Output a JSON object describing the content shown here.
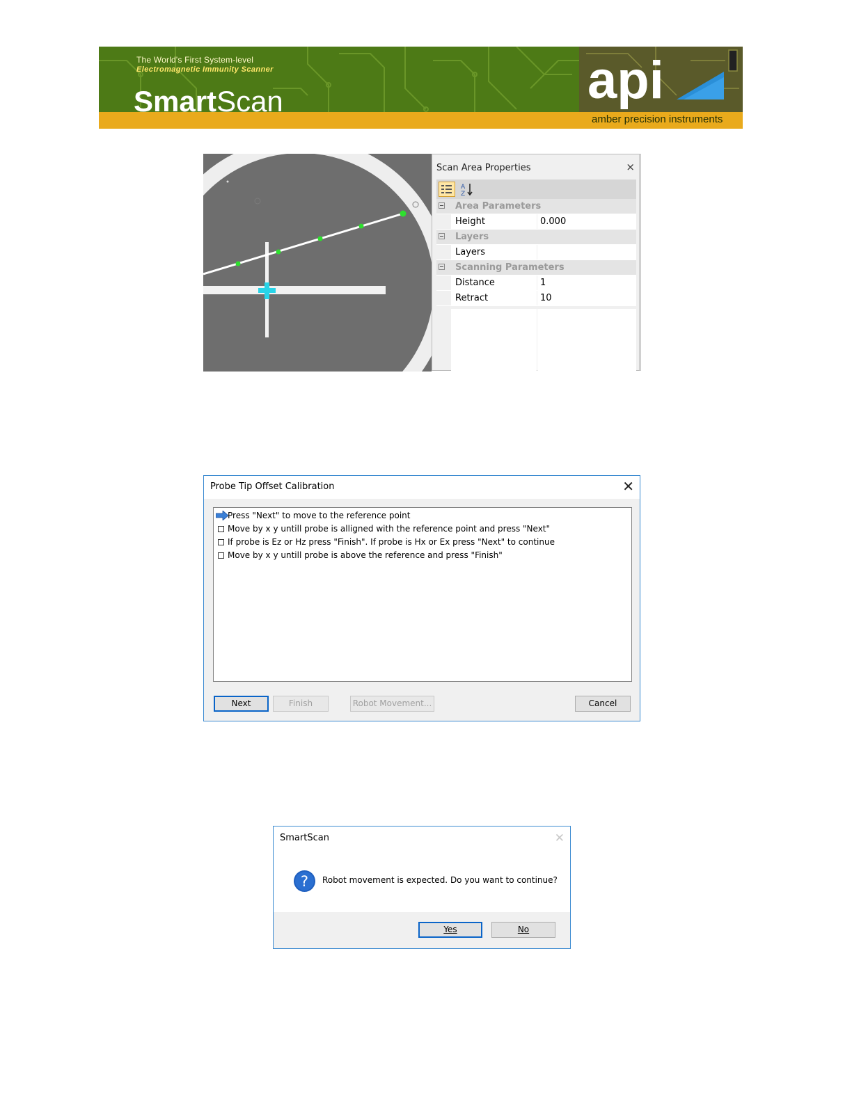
{
  "banner": {
    "tagline_line1": "The World's First System-level",
    "tagline_line2": "Electromagnetic Immunity Scanner",
    "brand_bold": "Smart",
    "brand_regular": "Scan",
    "logo_text": "api",
    "company": "amber precision instruments"
  },
  "scan_properties": {
    "title": "Scan Area Properties",
    "close_glyph": "×",
    "categories": [
      {
        "name": "Area Parameters",
        "props": [
          {
            "name": "Height",
            "value": "0.000"
          }
        ]
      },
      {
        "name": "Layers",
        "props": [
          {
            "name": "Layers",
            "value": ""
          }
        ]
      },
      {
        "name": "Scanning Parameters",
        "props": [
          {
            "name": "Distance",
            "value": "1"
          },
          {
            "name": "Retract",
            "value": "10"
          }
        ]
      }
    ]
  },
  "probe_dialog": {
    "title": "Probe Tip Offset Calibration",
    "close_glyph": "✕",
    "steps": [
      "Press \"Next\" to move to the reference point",
      "Move by x y untill probe is alligned with the reference point and press \"Next\"",
      "If probe is Ez or Hz press \"Finish\". If probe is Hx or Ex press \"Next\" to continue",
      "Move by x y untill probe is above the reference and press \"Finish\""
    ],
    "buttons": {
      "next": "Next",
      "finish": "Finish",
      "robot": "Robot Movement...",
      "cancel": "Cancel"
    }
  },
  "confirm_dialog": {
    "title": "SmartScan",
    "close_glyph": "✕",
    "message": "Robot movement is expected. Do you want to continue?",
    "icon_glyph": "?",
    "yes_label": "Yes",
    "no_label": "No"
  },
  "colors": {
    "banner_green": "#4d7a16",
    "banner_gold": "#e9aa1c",
    "accent_blue": "#0a64c8",
    "cursor_cyan": "#28d4e8",
    "point_green": "#2ee02e"
  }
}
